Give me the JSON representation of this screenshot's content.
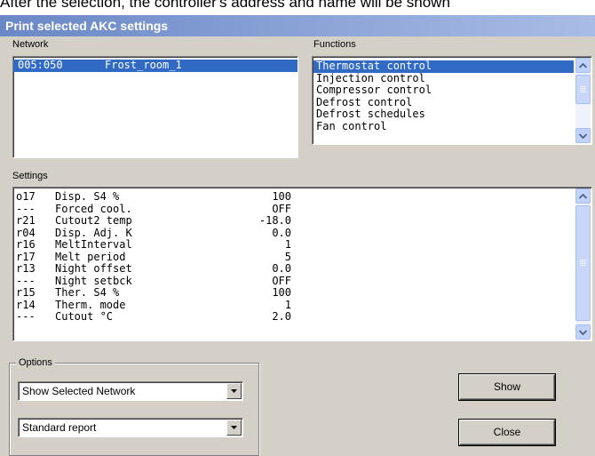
{
  "caption": "After the selection, the controller's address and name will be shown",
  "window": {
    "title": "Print selected AKC settings"
  },
  "network": {
    "label": "Network",
    "items": [
      {
        "address": "005:050",
        "name": "Frost_room_1",
        "selected": true
      }
    ]
  },
  "functions": {
    "label": "Functions",
    "items": [
      {
        "label": "Thermostat control",
        "selected": true
      },
      {
        "label": "Injection control",
        "selected": false
      },
      {
        "label": "Compressor control",
        "selected": false
      },
      {
        "label": "Defrost control",
        "selected": false
      },
      {
        "label": "Defrost schedules",
        "selected": false
      },
      {
        "label": "Fan control",
        "selected": false
      }
    ]
  },
  "settings": {
    "label": "Settings",
    "rows": [
      {
        "code": "o17",
        "name": "Disp. S4 %",
        "value": "100"
      },
      {
        "code": "---",
        "name": "Forced cool.",
        "value": "OFF"
      },
      {
        "code": "r21",
        "name": "Cutout2 temp",
        "value": "-18.0"
      },
      {
        "code": "r04",
        "name": "Disp. Adj. K",
        "value": "0.0"
      },
      {
        "code": "r16",
        "name": "MeltInterval",
        "value": "1"
      },
      {
        "code": "r17",
        "name": "Melt period",
        "value": "5"
      },
      {
        "code": "r13",
        "name": "Night offset",
        "value": "0.0"
      },
      {
        "code": "---",
        "name": "Night setbck",
        "value": "OFF"
      },
      {
        "code": "r15",
        "name": "Ther. S4 %",
        "value": "100"
      },
      {
        "code": "r14",
        "name": "Therm. mode",
        "value": "1"
      },
      {
        "code": "---",
        "name": "Cutout °C",
        "value": "2.0"
      }
    ]
  },
  "options": {
    "label": "Options",
    "network_select": "Show Selected Network",
    "report_select": "Standard report"
  },
  "buttons": {
    "show": "Show",
    "close": "Close"
  },
  "colors": {
    "title_bar_start": "#6a88c6",
    "title_bar_end": "#a9bce6",
    "selection": "#316ac5",
    "dialog_bg": "#d4d0c8"
  },
  "icons": {
    "scroll_up": "arrow-up-icon",
    "scroll_down": "arrow-down-icon",
    "dropdown": "chevron-down-icon"
  }
}
